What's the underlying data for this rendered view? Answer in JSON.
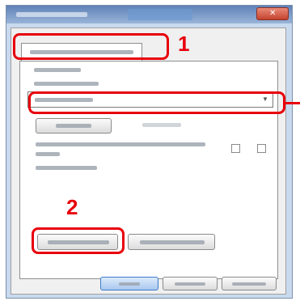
{
  "annotations": {
    "step1_label": "1",
    "step2_label": "2",
    "highlight_color": "#e8000b"
  },
  "window": {
    "icons": {
      "close": "close-icon",
      "dropdown": "chevron-down-icon"
    }
  }
}
